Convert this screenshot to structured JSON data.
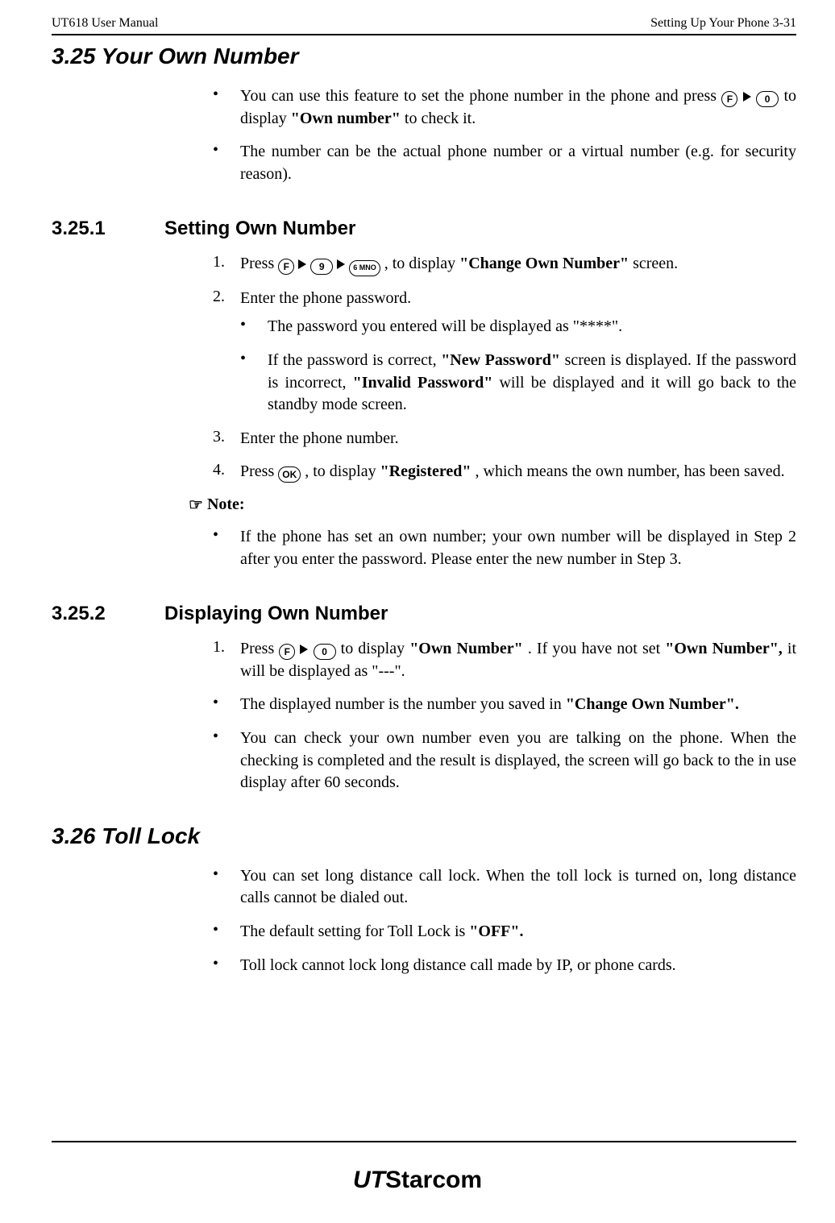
{
  "header": {
    "left": "UT618 User Manual",
    "right": "Setting Up Your Phone   3-31"
  },
  "s325": {
    "title": "3.25 Your Own Number",
    "bullets": [
      {
        "pre": "You can use this feature to set the phone number in the phone and press ",
        "mid": " to display ",
        "bold": "\"Own number\"",
        "post": " to check it."
      },
      {
        "text": "The number can be the actual phone number or a virtual number (e.g. for security reason)."
      }
    ]
  },
  "s3251": {
    "num": "3.25.1",
    "title": "Setting Own Number",
    "step1": {
      "mk": "1.",
      "pre": "Press ",
      "mid": ", to display ",
      "bold": "\"Change Own Number\"",
      "post": " screen."
    },
    "step2": {
      "mk": "2.",
      "text": "Enter the phone password."
    },
    "step2_sub1": "The password you entered will be displayed as \"****\".",
    "step2_sub2": {
      "pre": "If the password is correct, ",
      "b1": "\"New Password\"",
      "mid1": " screen is displayed. If the password is incorrect, ",
      "b2": "\"Invalid Password\"",
      "post": " will be displayed and it will go back to the standby mode screen."
    },
    "step3": {
      "mk": "3.",
      "text": "Enter the phone number."
    },
    "step4": {
      "mk": "4.",
      "pre": "Press ",
      "mid": ", to display ",
      "bold": "\"Registered\"",
      "post": ", which means the own number, has been saved."
    },
    "note_label": " Note:",
    "note_bullet": "If the phone has set an own number; your own number will be displayed in Step 2 after you enter the password. Please enter the new number in Step 3."
  },
  "s3252": {
    "num": "3.25.2",
    "title": "Displaying Own Number",
    "step1": {
      "mk": "1.",
      "pre": "Press ",
      "mid": " to display ",
      "b1": "\"Own Number\"",
      "mid2": ". If you have not set ",
      "b2": "\"Own Number\",",
      "post": " it will be displayed as \"---\"."
    },
    "b1": {
      "pre": "The displayed number is the number you saved in ",
      "bold": "\"Change Own Number\"."
    },
    "b2": "You can check your own number even you are talking on the phone. When the checking is completed and the result is displayed, the screen will go back to the in use display after 60 seconds."
  },
  "s326": {
    "title": "3.26 Toll Lock",
    "b1": "You can set long distance call lock. When the toll lock is turned on, long distance calls cannot be dialed out.",
    "b2": {
      "pre": "The default setting for Toll Lock is ",
      "bold": "\"OFF\"."
    },
    "b3": "Toll lock cannot lock long distance call made by IP, or phone cards."
  },
  "keys": {
    "F": "F",
    "0": "0",
    "9": "9",
    "6": "6 MNO",
    "OK": "OK"
  },
  "logo": {
    "ut": "UT",
    "rest": "Starcom"
  }
}
